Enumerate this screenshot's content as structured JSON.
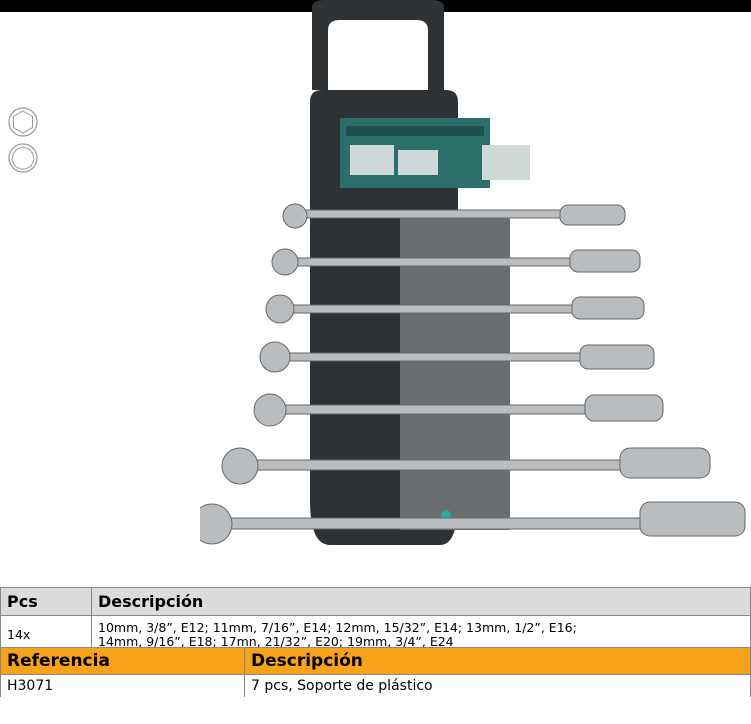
{
  "specs_table": {
    "headers": [
      "Pcs",
      "Descripción"
    ],
    "rows": [
      {
        "pcs": "14x",
        "line1": "10mm, 3/8”, E12; 11mm, 7/16”, E14; 12mm, 15/32”, E14; 13mm, 1/2”, E16;",
        "line2": "14mm, 9/16”, E18; 17mn, 21/32”, E20; 19mm, 3/4”, E24"
      }
    ]
  },
  "reference_table": {
    "headers": [
      "Referencia",
      "Descripción"
    ],
    "rows": [
      {
        "ref": "H3071",
        "desc": "7 pcs, Soporte de plástico"
      }
    ]
  },
  "icons": [
    "hex-socket-icon",
    "bihex-socket-icon"
  ],
  "colors": {
    "header_orange": "#f6a21a",
    "header_gray": "#dcdcdc",
    "holder": "#2e3234"
  }
}
